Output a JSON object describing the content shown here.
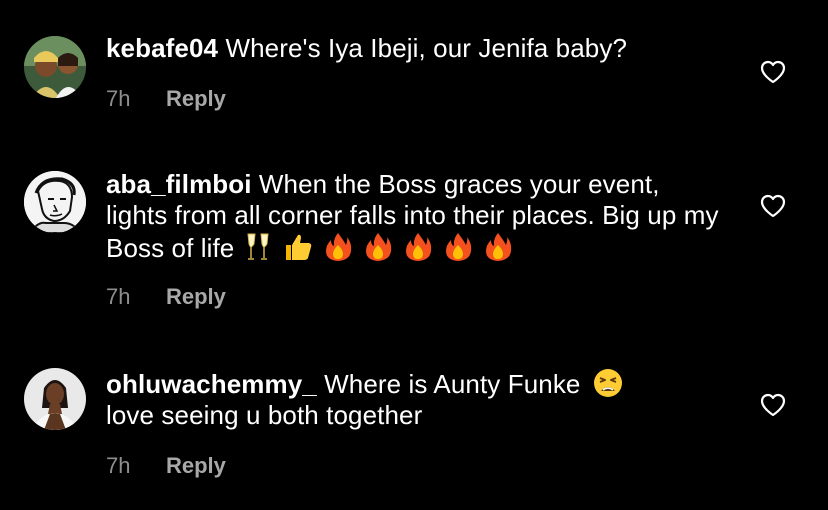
{
  "comments": [
    {
      "username": "kebafe04",
      "text": "Where's Iya Ibeji, our Jenifa baby?",
      "time": "7h",
      "reply_label": "Reply",
      "avatar": "user-avatar"
    },
    {
      "username": "aba_filmboi",
      "text": "When the Boss graces your event, lights from all corner falls into their places. Big up my Boss of life",
      "emojis": [
        "champagne-glasses",
        "thumbs-up",
        "fire",
        "fire",
        "fire",
        "fire",
        "fire"
      ],
      "time": "7h",
      "reply_label": "Reply",
      "avatar": "user-avatar"
    },
    {
      "username": "ohluwachemmy_",
      "text_before_emoji": "Where is Aunty Funke",
      "text_after_emoji": "love seeing u both together",
      "emoji": "tired-face",
      "time": "7h",
      "reply_label": "Reply",
      "avatar": "user-avatar"
    }
  ],
  "icons": {
    "like": "heart-outline-icon"
  },
  "colors": {
    "background": "#000000",
    "text": "#ffffff",
    "meta": "#8e8e8e"
  }
}
